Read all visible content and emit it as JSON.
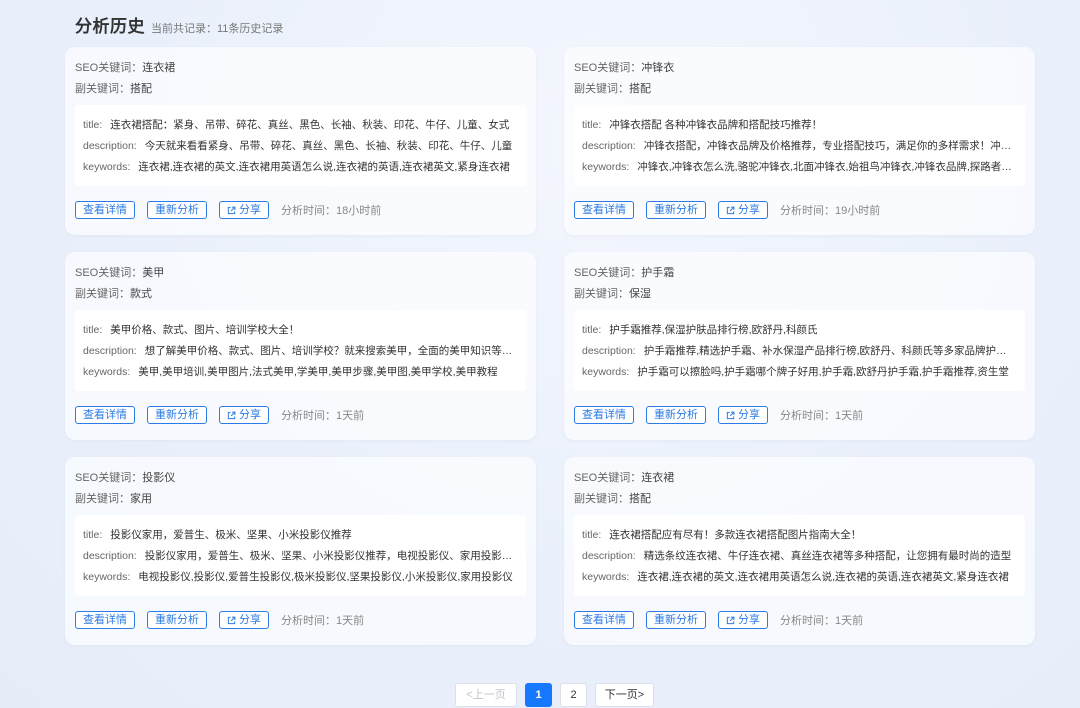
{
  "header": {
    "title": "分析历史",
    "subtitle": "当前共记录：11条历史记录"
  },
  "labels": {
    "seo_keyword": "SEO关键词：",
    "sub_keyword": "副关键词：",
    "title_key": "title:",
    "desc_key": "description:",
    "kw_key": "keywords:",
    "btn_detail": "查看详情",
    "btn_reanalyze": "重新分析",
    "btn_share": "分享",
    "time_label": "分析时间："
  },
  "cards": [
    {
      "seo": "连衣裙",
      "sub": "搭配",
      "title": "连衣裙搭配：紧身、吊带、碎花、真丝、黑色、长袖、秋装、印花、牛仔、儿童、女式",
      "description": "今天就来看看紧身、吊带、碎花、真丝、黑色、长袖、秋装、印花、牛仔、儿童",
      "keywords": "连衣裙,连衣裙的英文,连衣裙用英语怎么说,连衣裙的英语,连衣裙英文,紧身连衣裙",
      "time": "18小时前"
    },
    {
      "seo": "冲锋衣",
      "sub": "搭配",
      "title": "冲锋衣搭配 各种冲锋衣品牌和搭配技巧推荐！",
      "description": "冲锋衣搭配，冲锋衣品牌及价格推荐，专业搭配技巧，满足你的多样需求！冲锋衣",
      "keywords": "冲锋衣,冲锋衣怎么洗,骆驼冲锋衣,北面冲锋衣,始祖鸟冲锋衣,冲锋衣品牌,探路者冲锋衣",
      "time": "19小时前"
    },
    {
      "seo": "美甲",
      "sub": "款式",
      "title": "美甲价格、款式、图片、培训学校大全！",
      "description": "想了解美甲价格、款式、图片、培训学校？就来搜索美甲，全面的美甲知识等你来",
      "keywords": "美甲,美甲培训,美甲图片,法式美甲,学美甲,美甲步骤,美甲图,美甲学校,美甲教程",
      "time": "1天前"
    },
    {
      "seo": "护手霜",
      "sub": "保湿",
      "title": "护手霜推荐,保湿护肤品排行榜,欧舒丹,科颜氏",
      "description": "护手霜推荐,精选护手霜、补水保湿产品排行榜,欧舒丹、科颜氏等多家品牌护手霜",
      "keywords": "护手霜可以擦脸吗,护手霜哪个牌子好用,护手霜,欧舒丹护手霜,护手霜推荐,资生堂",
      "time": "1天前"
    },
    {
      "seo": "投影仪",
      "sub": "家用",
      "title": "投影仪家用，爱普生、极米、坚果、小米投影仪推荐",
      "description": "投影仪家用，爱普生、极米、坚果、小米投影仪推荐，电视投影仪、家用投影仪推荐",
      "keywords": "电视投影仪,投影仪,爱普生投影仪,极米投影仪,坚果投影仪,小米投影仪,家用投影仪",
      "time": "1天前"
    },
    {
      "seo": "连衣裙",
      "sub": "搭配",
      "title": "连衣裙搭配应有尽有！多款连衣裙搭配图片指南大全！",
      "description": "精选条纹连衣裙、牛仔连衣裙、真丝连衣裙等多种搭配，让您拥有最时尚的造型",
      "keywords": "连衣裙,连衣裙的英文,连衣裙用英语怎么说,连衣裙的英语,连衣裙英文,紧身连衣裙",
      "time": "1天前"
    }
  ],
  "pagination": {
    "prev": "<上一页",
    "pages": [
      "1",
      "2"
    ],
    "current": "1",
    "next": "下一页>"
  },
  "colors": {
    "accent": "#2d7be5",
    "active_page": "#1677ff"
  }
}
